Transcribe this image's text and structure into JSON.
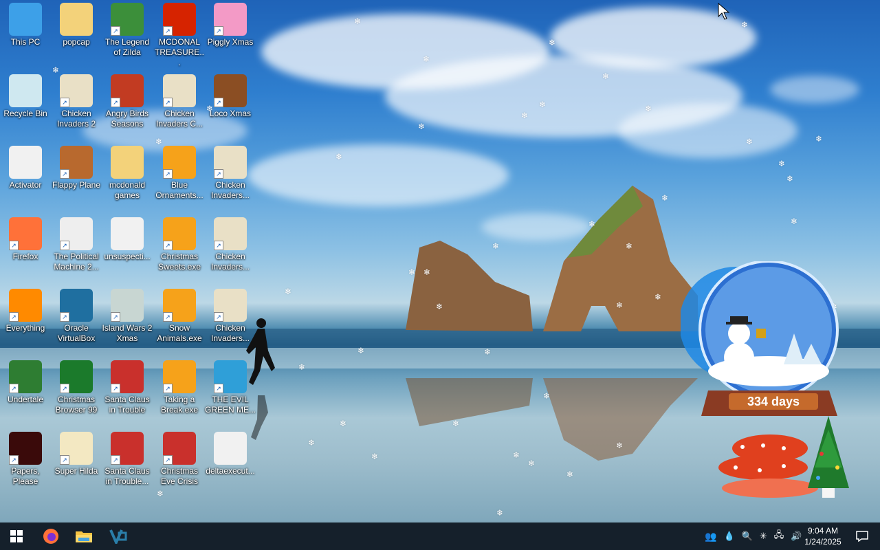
{
  "desktop": {
    "icons": [
      {
        "label": "This PC",
        "icon": "computer-icon"
      },
      {
        "label": "popcap",
        "icon": "folder-icon"
      },
      {
        "label": "The Legend of Zilda",
        "icon": "game-icon"
      },
      {
        "label": "MCDONAL TREASURE...",
        "icon": "mcdonalds-icon"
      },
      {
        "label": "Piggly Xmas",
        "icon": "pig-icon"
      },
      {
        "label": "Recycle Bin",
        "icon": "recycle-bin-icon"
      },
      {
        "label": "Chicken Invaders 2",
        "icon": "chicken-icon"
      },
      {
        "label": "Angry Birds Seasons",
        "icon": "angry-bird-icon"
      },
      {
        "label": "Chicken Invaders C...",
        "icon": "chicken-icon"
      },
      {
        "label": "Loco Xmas",
        "icon": "bear-icon"
      },
      {
        "label": "Activator",
        "icon": "document-icon"
      },
      {
        "label": "Flappy Plane",
        "icon": "plane-icon"
      },
      {
        "label": "mcdonald games",
        "icon": "folder-icon"
      },
      {
        "label": "Blue Ornaments...",
        "icon": "gift-icon"
      },
      {
        "label": "Chicken Invaders...",
        "icon": "chicken-icon"
      },
      {
        "label": "Firefox",
        "icon": "firefox-icon"
      },
      {
        "label": "The Political Machine 2...",
        "icon": "political-icon"
      },
      {
        "label": "unsuspecti...",
        "icon": "document-icon"
      },
      {
        "label": "Christmas Sweets.exe",
        "icon": "gift-icon"
      },
      {
        "label": "Chicken Invaders...",
        "icon": "chicken-icon"
      },
      {
        "label": "Everything",
        "icon": "search-icon"
      },
      {
        "label": "Oracle VirtualBox",
        "icon": "virtualbox-icon"
      },
      {
        "label": "Island Wars 2 Xmas",
        "icon": "island-icon"
      },
      {
        "label": "Snow Animals.exe",
        "icon": "gift-icon"
      },
      {
        "label": "Chicken Invaders...",
        "icon": "chicken-icon"
      },
      {
        "label": "Undertale",
        "icon": "undertale-icon"
      },
      {
        "label": "Christmas Browser 99",
        "icon": "christmas-tree-icon"
      },
      {
        "label": "Santa Claus in Trouble",
        "icon": "santa-icon"
      },
      {
        "label": "Taking a Break.exe",
        "icon": "gift-icon"
      },
      {
        "label": "THE EVIL GREEN ME...",
        "icon": "messenger-icon"
      },
      {
        "label": "Papers, Please",
        "icon": "papers-please-icon"
      },
      {
        "label": "Super Hilda",
        "icon": "pixel-icon"
      },
      {
        "label": "Santa Claus in Trouble...",
        "icon": "santa-icon"
      },
      {
        "label": "Christmas Eve Crisis",
        "icon": "santa-icon"
      },
      {
        "label": "deltaexecut...",
        "icon": "document-icon"
      }
    ]
  },
  "widget": {
    "days_label": "334 days"
  },
  "taskbar": {
    "pinned": [
      {
        "name": "start-button",
        "icon": "windows-icon"
      },
      {
        "name": "firefox-taskbar-button",
        "icon": "firefox-icon"
      },
      {
        "name": "file-explorer-button",
        "icon": "folder-icon"
      },
      {
        "name": "virtualbox-taskbar-button",
        "icon": "virtualbox-icon"
      }
    ],
    "time": "9:04 AM",
    "date": "1/24/2025"
  },
  "colors": {
    "taskbar": "#15202b",
    "icon_text": "#ffffff"
  }
}
